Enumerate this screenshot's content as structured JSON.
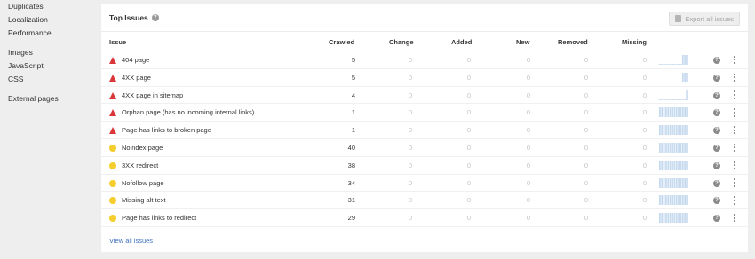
{
  "sidebar": {
    "groups": [
      [
        "Duplicates",
        "Localization",
        "Performance"
      ],
      [
        "Images",
        "JavaScript",
        "CSS"
      ],
      [
        "External pages"
      ]
    ]
  },
  "panel": {
    "title": "Top Issues",
    "help": "?",
    "export_label": "Export all issues",
    "columns": [
      "Issue",
      "Crawled",
      "Change",
      "Added",
      "New",
      "Removed",
      "Missing"
    ],
    "rows": [
      {
        "severity": "error",
        "issue": "404 page",
        "crawled": "5",
        "change": "0",
        "added": "0",
        "new": "0",
        "removed": "0",
        "missing": "0",
        "trend": [
          0,
          0,
          0,
          0,
          0,
          0,
          0,
          0,
          0,
          0,
          0,
          1,
          1,
          1
        ]
      },
      {
        "severity": "error",
        "issue": "4XX page",
        "crawled": "5",
        "change": "0",
        "added": "0",
        "new": "0",
        "removed": "0",
        "missing": "0",
        "trend": [
          0,
          0,
          0,
          0,
          0,
          0,
          0,
          0,
          0,
          0,
          0,
          1,
          1,
          1
        ]
      },
      {
        "severity": "error",
        "issue": "4XX page in sitemap",
        "crawled": "4",
        "change": "0",
        "added": "0",
        "new": "0",
        "removed": "0",
        "missing": "0",
        "trend": [
          0,
          0,
          0,
          0,
          0,
          0,
          0,
          0,
          0,
          0,
          0,
          0,
          0,
          1
        ]
      },
      {
        "severity": "error",
        "issue": "Orphan page (has no incoming internal links)",
        "crawled": "1",
        "change": "0",
        "added": "0",
        "new": "0",
        "removed": "0",
        "missing": "0",
        "trend": [
          1,
          1,
          1,
          1,
          1,
          1,
          1,
          1,
          1,
          1,
          1,
          1,
          1,
          1
        ]
      },
      {
        "severity": "error",
        "issue": "Page has links to broken page",
        "crawled": "1",
        "change": "0",
        "added": "0",
        "new": "0",
        "removed": "0",
        "missing": "0",
        "trend": [
          1,
          1,
          1,
          1,
          1,
          1,
          1,
          1,
          1,
          1,
          1,
          1,
          1,
          1
        ]
      },
      {
        "severity": "warning",
        "issue": "Noindex page",
        "crawled": "40",
        "change": "0",
        "added": "0",
        "new": "0",
        "removed": "0",
        "missing": "0",
        "trend": [
          1,
          1,
          1,
          1,
          1,
          1,
          1,
          1,
          1,
          1,
          1,
          1,
          1,
          1
        ]
      },
      {
        "severity": "warning",
        "issue": "3XX redirect",
        "crawled": "38",
        "change": "0",
        "added": "0",
        "new": "0",
        "removed": "0",
        "missing": "0",
        "trend": [
          1,
          1,
          1,
          1,
          1,
          1,
          1,
          1,
          1,
          1,
          1,
          1,
          1,
          1
        ]
      },
      {
        "severity": "warning",
        "issue": "Nofollow page",
        "crawled": "34",
        "change": "0",
        "added": "0",
        "new": "0",
        "removed": "0",
        "missing": "0",
        "trend": [
          1,
          1,
          1,
          1,
          1,
          1,
          1,
          1,
          1,
          1,
          1,
          1,
          1,
          1
        ]
      },
      {
        "severity": "warning",
        "issue": "Missing alt text",
        "crawled": "31",
        "change": "0",
        "added": "0",
        "new": "0",
        "removed": "0",
        "missing": "0",
        "trend": [
          1,
          1,
          1,
          1,
          1,
          1,
          1,
          1,
          1,
          1,
          1,
          1,
          1,
          1
        ]
      },
      {
        "severity": "warning",
        "issue": "Page has links to redirect",
        "crawled": "29",
        "change": "0",
        "added": "0",
        "new": "0",
        "removed": "0",
        "missing": "0",
        "trend": [
          1,
          1,
          1,
          1,
          1,
          1,
          1,
          1,
          1,
          1,
          1,
          1,
          1,
          1
        ]
      }
    ],
    "view_all_label": "View all issues"
  },
  "colors": {
    "error": "#d9373a",
    "warning": "#f5cd2c",
    "spark_bar": "#c5d9ef",
    "spark_last": "#8fb4de",
    "link": "#3a6ebd"
  }
}
